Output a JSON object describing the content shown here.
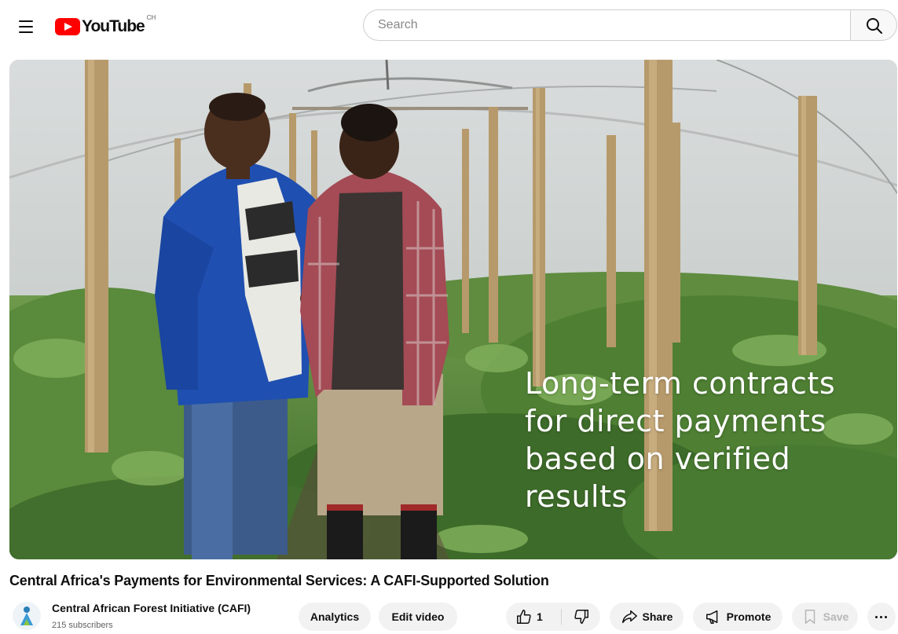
{
  "header": {
    "logo_text": "YouTube",
    "country_code": "CH",
    "search_placeholder": "Search"
  },
  "player": {
    "overlay_lines": [
      "Long-term contracts",
      "for direct payments",
      "based on verified",
      "results"
    ]
  },
  "video": {
    "title": "Central Africa's Payments for Environmental Services: A CAFI-Supported Solution"
  },
  "channel": {
    "name": "Central African Forest Initiative (CAFI)",
    "subscribers": "215 subscribers"
  },
  "actions": {
    "analytics_label": "Analytics",
    "edit_label": "Edit video",
    "like_count": "1",
    "share_label": "Share",
    "promote_label": "Promote",
    "save_label": "Save"
  },
  "colors": {
    "brand_red": "#ff0000",
    "pill_background": "#f2f2f2"
  }
}
